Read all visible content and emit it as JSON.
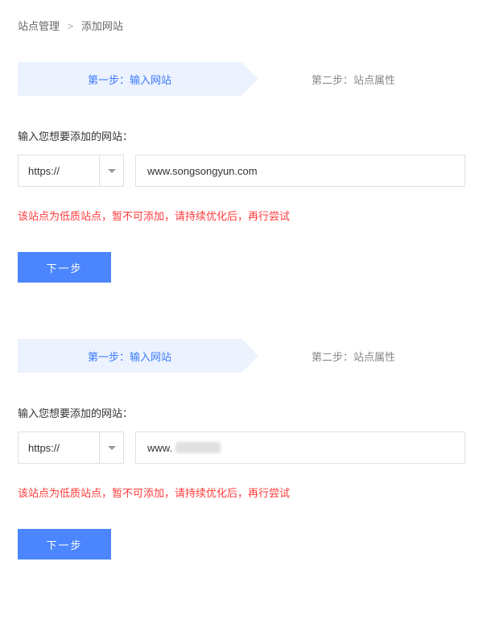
{
  "breadcrumb": {
    "item1": "站点管理",
    "sep": ">",
    "item2": "添加网站"
  },
  "steps": {
    "step1": "第一步：输入网站",
    "step2": "第二步：站点属性"
  },
  "form": {
    "label": "输入您想要添加的网站：",
    "protocol": "https://",
    "error": "该站点为低质站点，暂不可添加，请持续优化后，再行尝试",
    "submit": "下一步"
  },
  "panel1": {
    "url_value": "www.songsongyun.com"
  },
  "panel2": {
    "url_prefix": "www."
  }
}
